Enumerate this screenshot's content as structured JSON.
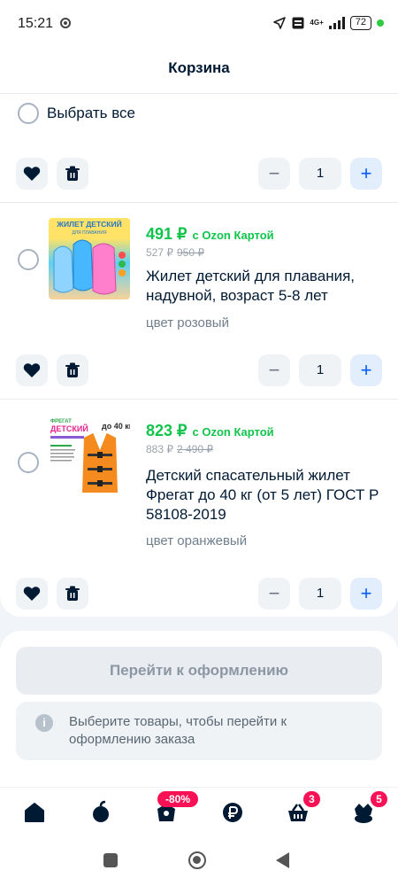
{
  "status_bar": {
    "time": "15:21",
    "network": "4G+",
    "battery": "72"
  },
  "header": {
    "title": "Корзина"
  },
  "cart": {
    "select_all_label": "Выбрать все",
    "items": [
      {
        "price": "491 ₽",
        "price_note": "с Ozon Картой",
        "price_regular": "527 ₽",
        "price_old": "950 ₽",
        "title": "Жилет детский для плавания, надувной, возраст 5-8 лет",
        "variant": "цвет розовый",
        "quantity": "1",
        "thumb_text": [
          "ЖИЛЕТ ДЕТСКИЙ",
          "ДЛЯ ПЛАВАНИЯ"
        ]
      },
      {
        "price": "823 ₽",
        "price_note": "с Ozon Картой",
        "price_regular": "883 ₽",
        "price_old": "2 490 ₽",
        "title": "Детский спасательный жилет Фрегат до 40 кг (от 5 лет) ГОСТ Р 58108-2019",
        "variant": "цвет оранжевый",
        "quantity": "1",
        "thumb_text": [
          "ФРЕГАТ",
          "ДЕТСКИЙ",
          "до 40 кг"
        ]
      }
    ],
    "top_quantity": "1"
  },
  "checkout": {
    "button_label": "Перейти к оформлению",
    "hint": "Выберите товары, чтобы перейти к оформлению заказа"
  },
  "tabbar": {
    "tabs": [
      {
        "icon": "home-icon"
      },
      {
        "icon": "fresh-icon"
      },
      {
        "icon": "sale-icon",
        "badge": "-80%"
      },
      {
        "icon": "ruble-icon"
      },
      {
        "icon": "cart-icon",
        "badge": "3"
      },
      {
        "icon": "profile-icon",
        "badge": "5"
      }
    ]
  },
  "colors": {
    "accent": "#005bff",
    "price": "#10c44c",
    "badge": "#f91155"
  }
}
